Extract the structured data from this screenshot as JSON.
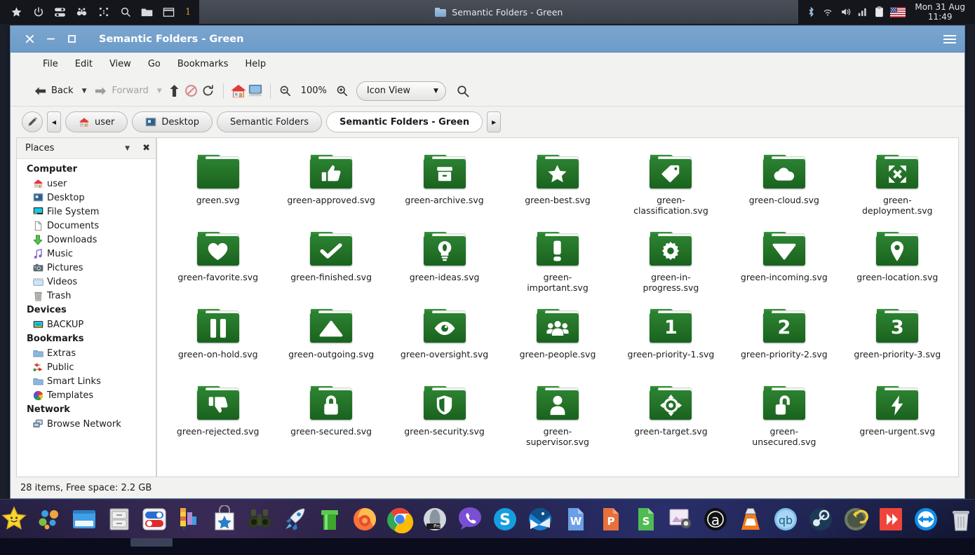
{
  "top_panel": {
    "launchers": [
      {
        "name": "star-icon",
        "glyph": "★"
      },
      {
        "name": "power-icon",
        "glyph": "⏻"
      },
      {
        "name": "toggle-settings-icon",
        "glyph": "⚏"
      },
      {
        "name": "binoculars-icon",
        "glyph": "🕶"
      },
      {
        "name": "grid-dots-icon",
        "glyph": "⣿"
      },
      {
        "name": "search-icon",
        "glyph": "🔍"
      },
      {
        "name": "folder-icon",
        "glyph": "📁"
      },
      {
        "name": "window-icon",
        "glyph": "❐"
      }
    ],
    "workspace_number": "1",
    "task_title": "Semantic Folders - Green",
    "tray": [
      {
        "name": "bluetooth-icon",
        "glyph": "✻"
      },
      {
        "name": "network-icon",
        "glyph": "◉"
      },
      {
        "name": "volume-icon",
        "glyph": "🔊"
      },
      {
        "name": "signal-icon",
        "glyph": "▂▄▆"
      },
      {
        "name": "clipboard-icon",
        "glyph": "📋"
      },
      {
        "name": "flag-icon",
        "glyph": "🇺🇸"
      }
    ],
    "clock_date": "Mon 31 Aug",
    "clock_time": "11:49"
  },
  "window": {
    "title": "Semantic Folders - Green",
    "controls": {
      "close": "✕",
      "minimize": "—",
      "maximize": "▢"
    },
    "menubar": [
      "File",
      "Edit",
      "View",
      "Go",
      "Bookmarks",
      "Help"
    ],
    "toolbar": {
      "back_label": "Back",
      "forward_label": "Forward",
      "zoom_level": "100%",
      "view_mode": "Icon View",
      "up_title": "Up",
      "stop_title": "Stop",
      "reload_title": "Reload",
      "home_title": "Home",
      "computer_title": "Computer",
      "zoom_out_title": "Zoom Out",
      "zoom_in_title": "Zoom In",
      "search_title": "Search"
    },
    "pathbar": [
      {
        "label": "user",
        "icon": "home-icon"
      },
      {
        "label": "Desktop",
        "icon": "desktop-icon"
      },
      {
        "label": "Semantic Folders",
        "icon": ""
      },
      {
        "label": "Semantic Folders - Green",
        "icon": "",
        "current": true
      }
    ],
    "statusbar": "28 items, Free space: 2.2 GB"
  },
  "sidebar": {
    "header": "Places",
    "groups": [
      {
        "title": "Computer",
        "items": [
          {
            "label": "user",
            "icon": "home-icon"
          },
          {
            "label": "Desktop",
            "icon": "desktop-icon"
          },
          {
            "label": "File System",
            "icon": "filesystem-icon"
          },
          {
            "label": "Documents",
            "icon": "documents-icon"
          },
          {
            "label": "Downloads",
            "icon": "downloads-icon"
          },
          {
            "label": "Music",
            "icon": "music-icon"
          },
          {
            "label": "Pictures",
            "icon": "pictures-icon"
          },
          {
            "label": "Videos",
            "icon": "videos-icon"
          },
          {
            "label": "Trash",
            "icon": "trash-icon"
          }
        ]
      },
      {
        "title": "Devices",
        "items": [
          {
            "label": "BACKUP",
            "icon": "drive-icon"
          }
        ]
      },
      {
        "title": "Bookmarks",
        "items": [
          {
            "label": "Extras",
            "icon": "folder-icon"
          },
          {
            "label": "Public",
            "icon": "public-icon"
          },
          {
            "label": "Smart Links",
            "icon": "folder-icon"
          },
          {
            "label": "Templates",
            "icon": "templates-icon"
          }
        ]
      },
      {
        "title": "Network",
        "items": [
          {
            "label": "Browse Network",
            "icon": "network-icon"
          }
        ]
      }
    ]
  },
  "files": [
    {
      "label": "green.svg",
      "glyph": "plain"
    },
    {
      "label": "green-approved.svg",
      "glyph": "thumbs-up"
    },
    {
      "label": "green-archive.svg",
      "glyph": "archive-box"
    },
    {
      "label": "green-best.svg",
      "glyph": "star"
    },
    {
      "label": "green-classification.svg",
      "glyph": "tag"
    },
    {
      "label": "green-cloud.svg",
      "glyph": "cloud"
    },
    {
      "label": "green-deployment.svg",
      "glyph": "expand-arrows"
    },
    {
      "label": "green-favorite.svg",
      "glyph": "heart"
    },
    {
      "label": "green-finished.svg",
      "glyph": "check"
    },
    {
      "label": "green-ideas.svg",
      "glyph": "bulb"
    },
    {
      "label": "green-important.svg",
      "glyph": "exclamation"
    },
    {
      "label": "green-in-progress.svg",
      "glyph": "gear"
    },
    {
      "label": "green-incoming.svg",
      "glyph": "triangle-down"
    },
    {
      "label": "green-location.svg",
      "glyph": "pin"
    },
    {
      "label": "green-on-hold.svg",
      "glyph": "pause"
    },
    {
      "label": "green-outgoing.svg",
      "glyph": "triangle-up"
    },
    {
      "label": "green-oversight.svg",
      "glyph": "eye"
    },
    {
      "label": "green-people.svg",
      "glyph": "people"
    },
    {
      "label": "green-priority-1.svg",
      "glyph": "num",
      "text": "1"
    },
    {
      "label": "green-priority-2.svg",
      "glyph": "num",
      "text": "2"
    },
    {
      "label": "green-priority-3.svg",
      "glyph": "num",
      "text": "3"
    },
    {
      "label": "green-rejected.svg",
      "glyph": "thumbs-down"
    },
    {
      "label": "green-secured.svg",
      "glyph": "lock"
    },
    {
      "label": "green-security.svg",
      "glyph": "shield"
    },
    {
      "label": "green-supervisor.svg",
      "glyph": "person"
    },
    {
      "label": "green-target.svg",
      "glyph": "target"
    },
    {
      "label": "green-unsecured.svg",
      "glyph": "unlock"
    },
    {
      "label": "green-urgent.svg",
      "glyph": "bolt"
    }
  ],
  "dock": [
    {
      "name": "dock-star-icon",
      "glyph": "⭐"
    },
    {
      "name": "dock-bubbles-icon",
      "glyph": "🫧"
    },
    {
      "name": "dock-window-icon",
      "glyph": "🪟"
    },
    {
      "name": "dock-filecabinet-icon",
      "glyph": "🗄"
    },
    {
      "name": "dock-settings-icon",
      "glyph": "🎛"
    },
    {
      "name": "dock-palette-icon",
      "glyph": "🎨"
    },
    {
      "name": "dock-software-icon",
      "glyph": "🛍"
    },
    {
      "name": "dock-binoculars-icon",
      "glyph": "🔭"
    },
    {
      "name": "dock-rocket-icon",
      "glyph": "🚀"
    },
    {
      "name": "dock-pipe-icon",
      "glyph": "🪣"
    },
    {
      "name": "dock-firefox-icon",
      "glyph": "🦊"
    },
    {
      "name": "dock-chrome-icon",
      "glyph": "🌐"
    },
    {
      "name": "dock-opera-icon",
      "glyph": "🔘"
    },
    {
      "name": "dock-viber-icon",
      "glyph": "📞"
    },
    {
      "name": "dock-skype-icon",
      "glyph": "Ⓢ"
    },
    {
      "name": "dock-thunderbird-icon",
      "glyph": "✉"
    },
    {
      "name": "dock-word-icon",
      "glyph": "W"
    },
    {
      "name": "dock-powerpoint-icon",
      "glyph": "P"
    },
    {
      "name": "dock-sheets-icon",
      "glyph": "S"
    },
    {
      "name": "dock-screenshot-icon",
      "glyph": "📷"
    },
    {
      "name": "dock-audacious-icon",
      "glyph": "ⓐ"
    },
    {
      "name": "dock-vlc-icon",
      "glyph": "🔺"
    },
    {
      "name": "dock-qbittorrent-icon",
      "glyph": "qb"
    },
    {
      "name": "dock-steam-icon",
      "glyph": "♨"
    },
    {
      "name": "dock-timeshift-icon",
      "glyph": "↩"
    },
    {
      "name": "dock-anydesk-icon",
      "glyph": "❯"
    },
    {
      "name": "dock-teamviewer-icon",
      "glyph": "↔"
    },
    {
      "name": "dock-trash-icon",
      "glyph": "🗑"
    }
  ],
  "colors": {
    "folder_green_light": "#35913a",
    "folder_green_dark": "#18621f",
    "titlebar_blue": "#6d9cc9",
    "panel_bg": "#14161c"
  }
}
